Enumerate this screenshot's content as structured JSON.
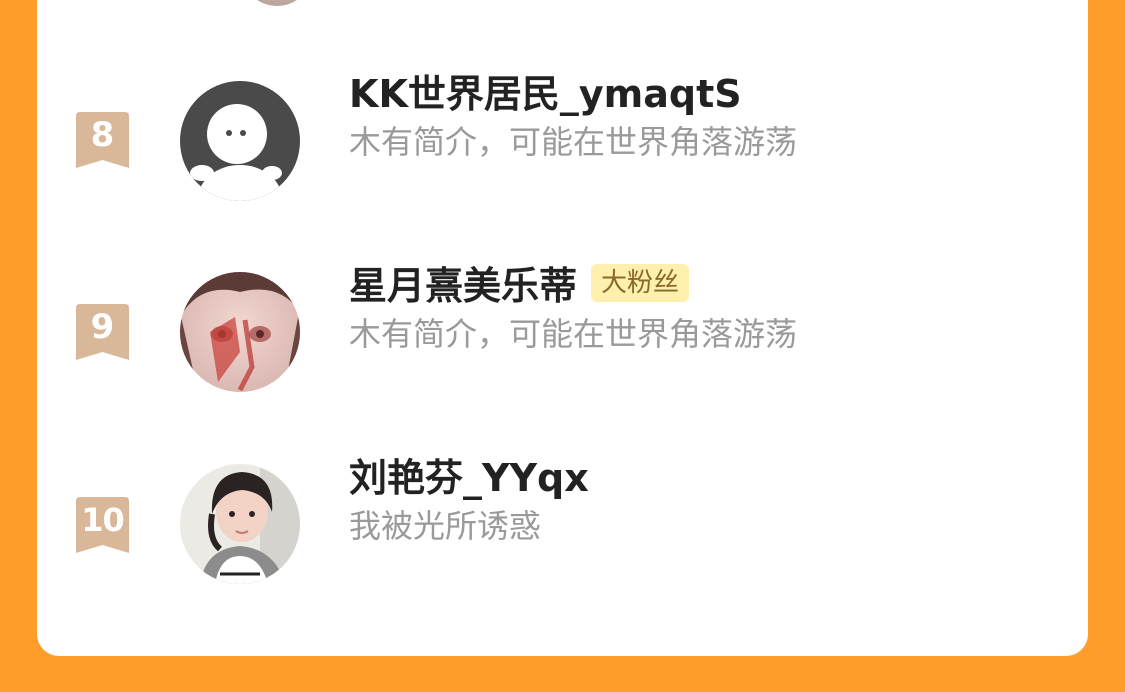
{
  "fans": [
    {
      "rank": "8",
      "name": "KK世界居民_ymaqtS",
      "badge": "",
      "bio": "木有简介，可能在世界角落游荡",
      "avatar": "default-silhouette-icon"
    },
    {
      "rank": "9",
      "name": "星月熹美乐蒂",
      "badge": "大粉丝",
      "bio": "木有简介，可能在世界角落游荡",
      "avatar": "anime-girl-avatar"
    },
    {
      "rank": "10",
      "name": "刘艳芬_YYqx",
      "badge": "",
      "bio": "我被光所诱惑",
      "avatar": "girl-photo-avatar"
    }
  ],
  "colors": {
    "page_bg": "#FF9D2A",
    "card_bg": "#FFFFFF",
    "rank_flag": "#D9B89A",
    "name": "#222222",
    "bio": "#9A9A9A",
    "badge_bg": "#FFF0B0",
    "badge_text": "#8A6A2A"
  }
}
